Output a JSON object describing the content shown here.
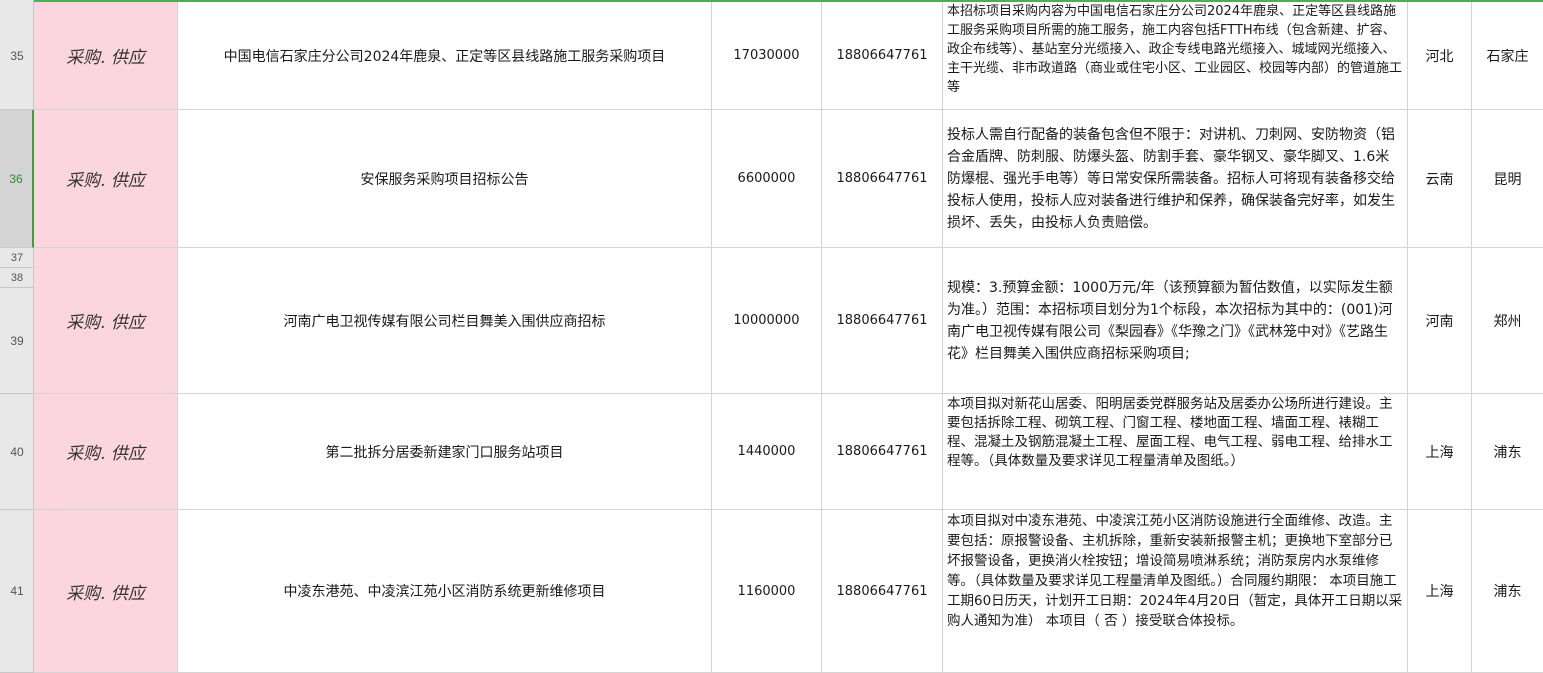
{
  "sheet": {
    "rows": [
      {
        "row_num": "35",
        "category": "采购. 供应",
        "title": "中国电信石家庄分公司2024年鹿泉、正定等区县线路施工服务采购项目",
        "amount": "17030000",
        "phone": "18806647761",
        "description": "本招标项目采购内容为中国电信石家庄分公司2024年鹿泉、正定等区县线路施工服务采购项目所需的施工服务，施工内容包括FTTH布线（包含新建、扩容、政企布线等）、基站室分光缆接入、政企专线电路光缆接入、城域网光缆接入、主干光缆、非市政道路（商业或住宅小区、工业园区、校园等内部）的管道施工等",
        "province": "河北",
        "city": "石家庄"
      },
      {
        "row_num": "36",
        "category": "采购. 供应",
        "title": "安保服务采购项目招标公告",
        "amount": "6600000",
        "phone": "18806647761",
        "description": "投标人需自行配备的装备包含但不限于：对讲机、刀刺网、安防物资（铝合金盾牌、防刺服、防爆头盔、防割手套、豪华钢叉、豪华脚叉、1.6米防爆棍、强光手电等）等日常安保所需装备。招标人可将现有装备移交给投标人使用，投标人应对装备进行维护和保养，确保装备完好率，如发生损坏、丢失，由投标人负责赔偿。",
        "province": "云南",
        "city": "昆明"
      },
      {
        "row_num": "39",
        "category": "采购. 供应",
        "title": "河南广电卫视传媒有限公司栏目舞美入围供应商招标",
        "amount": "10000000",
        "phone": "18806647761",
        "description": "规模：3.预算金额：1000万元/年（该预算额为暂估数值，以实际发生额为准。）范围：本招标项目划分为1个标段，本次招标为其中的：(001)河南广电卫视传媒有限公司《梨园春》《华豫之门》《武林笼中对》《艺路生花》栏目舞美入围供应商招标采购项目;",
        "province": "河南",
        "city": "郑州"
      },
      {
        "row_num": "40",
        "category": "采购. 供应",
        "title": "第二批拆分居委新建家门口服务站项目",
        "amount": "1440000",
        "phone": "18806647761",
        "description": "本项目拟对新花山居委、阳明居委党群服务站及居委办公场所进行建设。主要包括拆除工程、砌筑工程、门窗工程、楼地面工程、墙面工程、裱糊工程、混凝土及钢筋混凝土工程、屋面工程、电气工程、弱电工程、给排水工程等。（具体数量及要求详见工程量清单及图纸。）",
        "province": "上海",
        "city": "浦东"
      },
      {
        "row_num": "41",
        "category": "采购. 供应",
        "title": "中凌东港苑、中凌滨江苑小区消防系统更新维修项目",
        "amount": "1160000",
        "phone": "18806647761",
        "description": "本项目拟对中凌东港苑、中凌滨江苑小区消防设施进行全面维修、改造。主要包括：原报警设备、主机拆除，重新安装新报警主机；更换地下室部分已坏报警设备，更换消火栓按钮；增设简易喷淋系统；消防泵房内水泵维修等。（具体数量及要求详见工程量清单及图纸。）合同履约期限： 本项目施工工期60日历天，计划开工日期：2024年4月20日（暂定，具体开工日期以采购人通知为准） 本项目（ 否 ）接受联合体投标。",
        "province": "上海",
        "city": "浦东"
      }
    ],
    "hidden_row_labels": [
      "37",
      "38"
    ]
  }
}
